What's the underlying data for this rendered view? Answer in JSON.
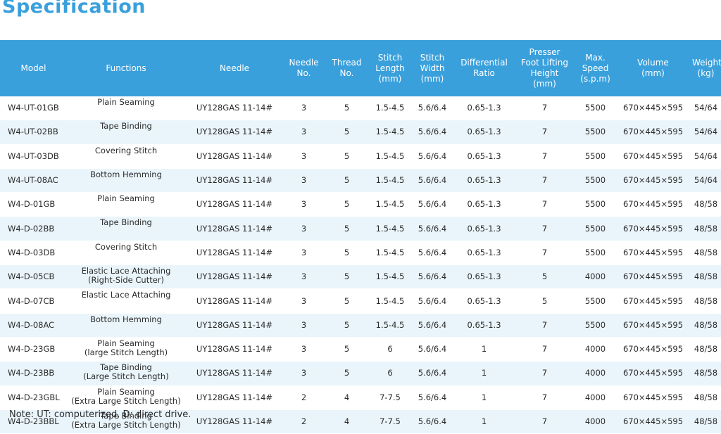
{
  "title": "Specification",
  "columns": [
    "Model",
    "Functions",
    "Needle",
    "Needle\nNo.",
    "Thread\nNo.",
    "Stitch\nLength\n(mm)",
    "Stitch\nWidth\n(mm)",
    "Differential\nRatio",
    "Presser\nFoot Lifting\nHeight\n(mm)",
    "Max.\nSpeed\n(s.p.m)",
    "Volume\n(mm)",
    "Weight\n(kg)"
  ],
  "rows": [
    [
      "W4-UT-01GB",
      "Plain Seaming",
      "UY128GAS 11-14#",
      "3",
      "5",
      "1.5-4.5",
      "5.6/6.4",
      "0.65-1.3",
      "7",
      "5500",
      "670×445×595",
      "54/64"
    ],
    [
      "W4-UT-02BB",
      "Tape Binding",
      "UY128GAS 11-14#",
      "3",
      "5",
      "1.5-4.5",
      "5.6/6.4",
      "0.65-1.3",
      "7",
      "5500",
      "670×445×595",
      "54/64"
    ],
    [
      "W4-UT-03DB",
      "Covering Stitch",
      "UY128GAS 11-14#",
      "3",
      "5",
      "1.5-4.5",
      "5.6/6.4",
      "0.65-1.3",
      "7",
      "5500",
      "670×445×595",
      "54/64"
    ],
    [
      "W4-UT-08AC",
      "Bottom Hemming",
      "UY128GAS 11-14#",
      "3",
      "5",
      "1.5-4.5",
      "5.6/6.4",
      "0.65-1.3",
      "7",
      "5500",
      "670×445×595",
      "54/64"
    ],
    [
      "W4-D-01GB",
      "Plain Seaming",
      "UY128GAS 11-14#",
      "3",
      "5",
      "1.5-4.5",
      "5.6/6.4",
      "0.65-1.3",
      "7",
      "5500",
      "670×445×595",
      "48/58"
    ],
    [
      "W4-D-02BB",
      "Tape Binding",
      "UY128GAS 11-14#",
      "3",
      "5",
      "1.5-4.5",
      "5.6/6.4",
      "0.65-1.3",
      "7",
      "5500",
      "670×445×595",
      "48/58"
    ],
    [
      "W4-D-03DB",
      "Covering Stitch",
      "UY128GAS 11-14#",
      "3",
      "5",
      "1.5-4.5",
      "5.6/6.4",
      "0.65-1.3",
      "7",
      "5500",
      "670×445×595",
      "48/58"
    ],
    [
      "W4-D-05CB",
      "Elastic Lace Attaching\n(Right-Side Cutter)",
      "UY128GAS 11-14#",
      "3",
      "5",
      "1.5-4.5",
      "5.6/6.4",
      "0.65-1.3",
      "5",
      "4000",
      "670×445×595",
      "48/58"
    ],
    [
      "W4-D-07CB",
      "Elastic Lace Attaching",
      "UY128GAS 11-14#",
      "3",
      "5",
      "1.5-4.5",
      "5.6/6.4",
      "0.65-1.3",
      "5",
      "5500",
      "670×445×595",
      "48/58"
    ],
    [
      "W4-D-08AC",
      "Bottom Hemming",
      "UY128GAS 11-14#",
      "3",
      "5",
      "1.5-4.5",
      "5.6/6.4",
      "0.65-1.3",
      "7",
      "5500",
      "670×445×595",
      "48/58"
    ],
    [
      "W4-D-23GB",
      "Plain Seaming\n(large Stitch Length)",
      "UY128GAS 11-14#",
      "3",
      "5",
      "6",
      "5.6/6.4",
      "1",
      "7",
      "4000",
      "670×445×595",
      "48/58"
    ],
    [
      "W4-D-23BB",
      "Tape Binding\n(Large Stitch Length)",
      "UY128GAS 11-14#",
      "3",
      "5",
      "6",
      "5.6/6.4",
      "1",
      "7",
      "4000",
      "670×445×595",
      "48/58"
    ],
    [
      "W4-D-23GBL",
      "Plain Seaming\n(Extra Large Stitch Length)",
      "UY128GAS 11-14#",
      "2",
      "4",
      "7-7.5",
      "5.6/6.4",
      "1",
      "7",
      "4000",
      "670×445×595",
      "48/58"
    ],
    [
      "W4-D-23BBL",
      "Tape Binding\n(Extra Large Stitch Length)",
      "UY128GAS 11-14#",
      "2",
      "4",
      "7-7.5",
      "5.6/6.4",
      "1",
      "7",
      "4000",
      "670×445×595",
      "48/58"
    ]
  ],
  "note": "Note: UT: computerized, D: direct drive.",
  "colors": {
    "accent": "#3aa0dc",
    "row_shade": "#eaf5fb",
    "text": "#2b2b2b"
  }
}
